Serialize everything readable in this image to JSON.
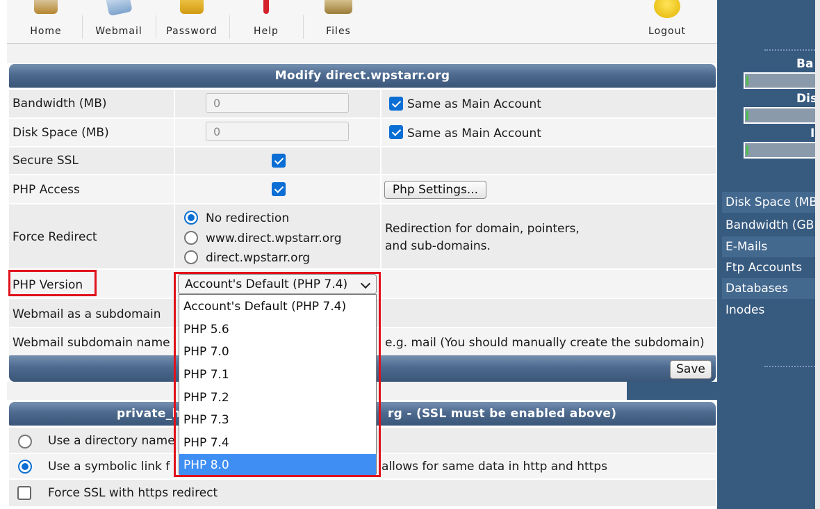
{
  "nav": {
    "items": [
      {
        "label": "Home",
        "icon": "home-icon"
      },
      {
        "label": "Webmail",
        "icon": "webmail-icon"
      },
      {
        "label": "Password",
        "icon": "password-icon"
      },
      {
        "label": "Help",
        "icon": "help-icon"
      },
      {
        "label": "Files",
        "icon": "files-icon"
      },
      {
        "label": "Logout",
        "icon": "logout-icon"
      }
    ]
  },
  "modify": {
    "title": "Modify direct.wpstarr.org",
    "bandwidth": {
      "label": "Bandwidth (MB)",
      "value": "0",
      "same_label": "Same as Main Account",
      "same_checked": true
    },
    "disk": {
      "label": "Disk Space (MB)",
      "value": "0",
      "same_label": "Same as Main Account",
      "same_checked": true
    },
    "ssl": {
      "label": "Secure SSL",
      "checked": true
    },
    "php": {
      "label": "PHP Access",
      "checked": true,
      "settings_button": "Php Settings..."
    },
    "redirect": {
      "label": "Force Redirect",
      "options": [
        "No redirection",
        "www.direct.wpstarr.org",
        "direct.wpstarr.org"
      ],
      "selected": 0,
      "note_line1": "Redirection for domain, pointers,",
      "note_line2": "and sub-domains."
    },
    "php_version": {
      "label": "PHP Version",
      "selected": "Account's Default (PHP 7.4)",
      "options": [
        "Account's Default (PHP 7.4)",
        "PHP 5.6",
        "PHP 7.0",
        "PHP 7.1",
        "PHP 7.2",
        "PHP 7.3",
        "PHP 7.4",
        "PHP 8.0"
      ],
      "highlighted": "PHP 8.0"
    },
    "webmail_subdomain": {
      "label": "Webmail as a subdomain"
    },
    "webmail_name": {
      "label": "Webmail subdomain name",
      "hint": "e.g. mail (You should manually create the subdomain)"
    },
    "save_button": "Save"
  },
  "private_html": {
    "title_left": "private_h",
    "title_right": "rg - (SSL must be enabled above)",
    "option_dir": "Use a directory name",
    "option_link_start": "Use a symbolic link f",
    "option_link_end": "allows for same data in http and https",
    "force_ssl": "Force SSL with https redirect"
  },
  "sidebar": {
    "bars": [
      {
        "label": "Ba",
        "fill_fraction": 0.01
      },
      {
        "label": "Dis",
        "fill_fraction": 0.01
      },
      {
        "label": "I",
        "fill_fraction": 0.01
      }
    ],
    "items": [
      "Disk Space (MB",
      "Bandwidth (GB",
      "E-Mails",
      "Ftp Accounts",
      "Databases",
      "Inodes"
    ]
  },
  "colors": {
    "accent": "#0b6ed4",
    "header": "#4d6a8f",
    "sidebar": "#375a7f",
    "highlight": "#e0121b",
    "selected_option": "#3e8ef4"
  }
}
